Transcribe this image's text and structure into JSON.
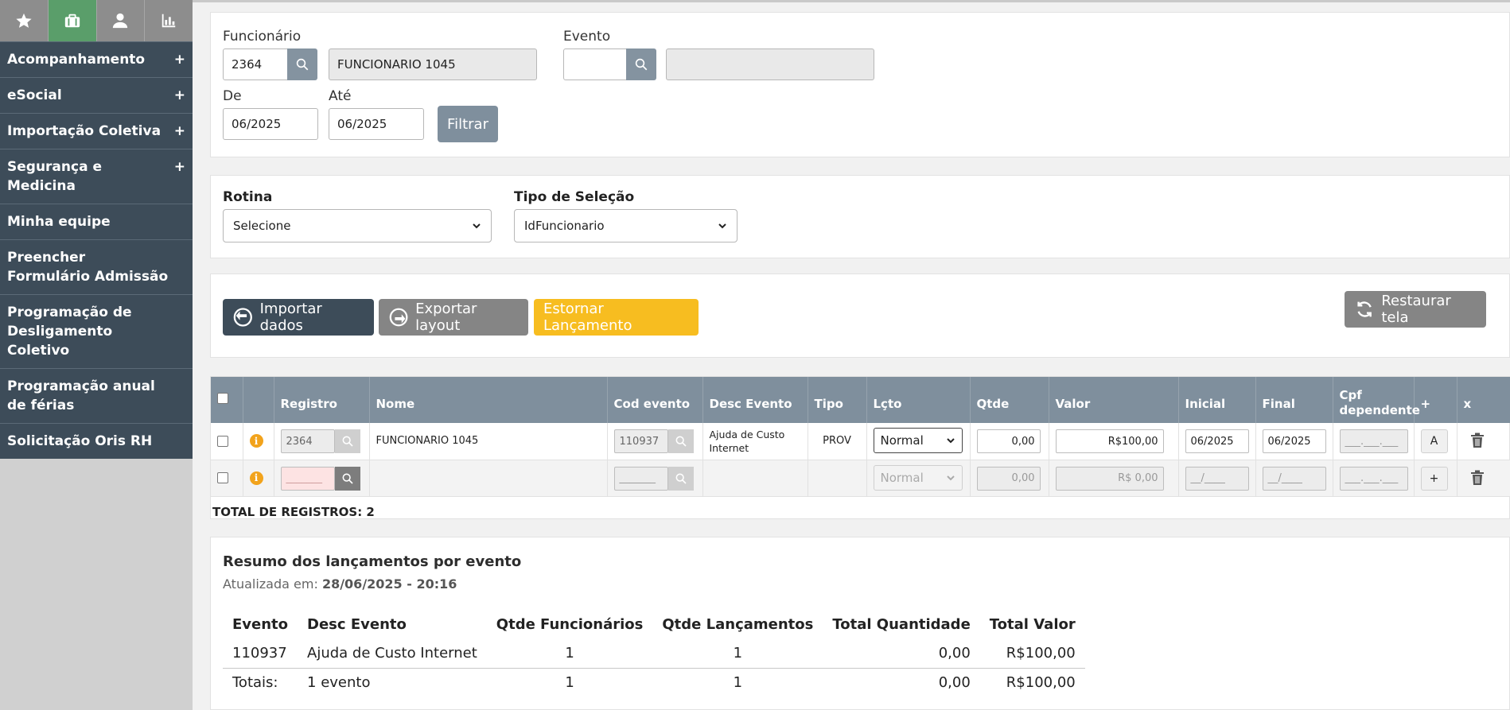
{
  "sidebar": {
    "tabs": [
      {
        "icon": "star-icon"
      },
      {
        "icon": "briefcase-icon",
        "active": true
      },
      {
        "icon": "user-icon"
      },
      {
        "icon": "bar-chart-icon"
      }
    ],
    "items": [
      {
        "label": "Acompanhamento",
        "plus": "+"
      },
      {
        "label": "eSocial",
        "plus": "+"
      },
      {
        "label": "Importação Coletiva",
        "plus": "+"
      },
      {
        "label": "Segurança e Medicina",
        "plus": "+"
      },
      {
        "label": "Minha equipe"
      },
      {
        "label": "Preencher Formulário Admissão"
      },
      {
        "label": "Programação de Desligamento Coletivo"
      },
      {
        "label": "Programação anual de férias"
      },
      {
        "label": "Solicitação Oris RH"
      }
    ]
  },
  "filters": {
    "funcionario_label": "Funcionário",
    "funcionario_code": "2364",
    "funcionario_name": "FUNCIONARIO 1045",
    "evento_label": "Evento",
    "evento_code": "",
    "evento_desc": "",
    "de_label": "De",
    "de_value": "06/2025",
    "ate_label": "Até",
    "ate_value": "06/2025",
    "filtrar_label": "Filtrar"
  },
  "selection": {
    "rotina_label": "Rotina",
    "rotina_value": "Selecione",
    "tipo_label": "Tipo de Seleção",
    "tipo_value": "IdFuncionario"
  },
  "actions": {
    "importar": "Importar dados",
    "exportar": "Exportar layout",
    "estornar": "Estornar Lançamento",
    "restaurar": "Restaurar tela"
  },
  "grid": {
    "headers": {
      "registro": "Registro",
      "nome": "Nome",
      "cod_evento": "Cod evento",
      "desc_evento": "Desc Evento",
      "tipo": "Tipo",
      "lcto": "Lçto",
      "qtde": "Qtde",
      "valor": "Valor",
      "inicial": "Inicial",
      "final": "Final",
      "cpf": "Cpf dependente",
      "plus": "+",
      "x": "x"
    },
    "rows": [
      {
        "registro": "2364",
        "nome": "FUNCIONARIO 1045",
        "cod_evento": "110937",
        "desc_evento": "Ajuda de Custo Internet",
        "tipo": "PROV",
        "lcto": "Normal",
        "qtde": "0,00",
        "valor": "R$100,00",
        "inicial": "06/2025",
        "final": "06/2025",
        "cpf": "___.___.___",
        "action": "A"
      },
      {
        "registro": "_______",
        "nome": "",
        "cod_evento": "_______",
        "desc_evento": "",
        "tipo": "",
        "lcto": "Normal",
        "qtde": "0,00",
        "valor": "R$ 0,00",
        "inicial": "__/____",
        "final": "__/____",
        "cpf": "___.___.___",
        "action": "+"
      }
    ],
    "total_label": "TOTAL DE REGISTROS: 2"
  },
  "summary": {
    "title": "Resumo dos lançamentos por evento",
    "updated_label": "Atualizada em:",
    "updated_value": "28/06/2025 - 20:16",
    "headers": {
      "evento": "Evento",
      "desc": "Desc Evento",
      "qtde_func": "Qtde Funcionários",
      "qtde_lanc": "Qtde Lançamentos",
      "total_qtd": "Total Quantidade",
      "total_valor": "Total Valor"
    },
    "row": {
      "evento": "110937",
      "desc": "Ajuda de Custo Internet",
      "qtde_func": "1",
      "qtde_lanc": "1",
      "total_qtd": "0,00",
      "total_valor": "R$100,00"
    },
    "totals": {
      "label": "Totais:",
      "desc": "1 evento",
      "qtde_func": "1",
      "qtde_lanc": "1",
      "total_qtd": "0,00",
      "total_valor": "R$100,00"
    }
  }
}
